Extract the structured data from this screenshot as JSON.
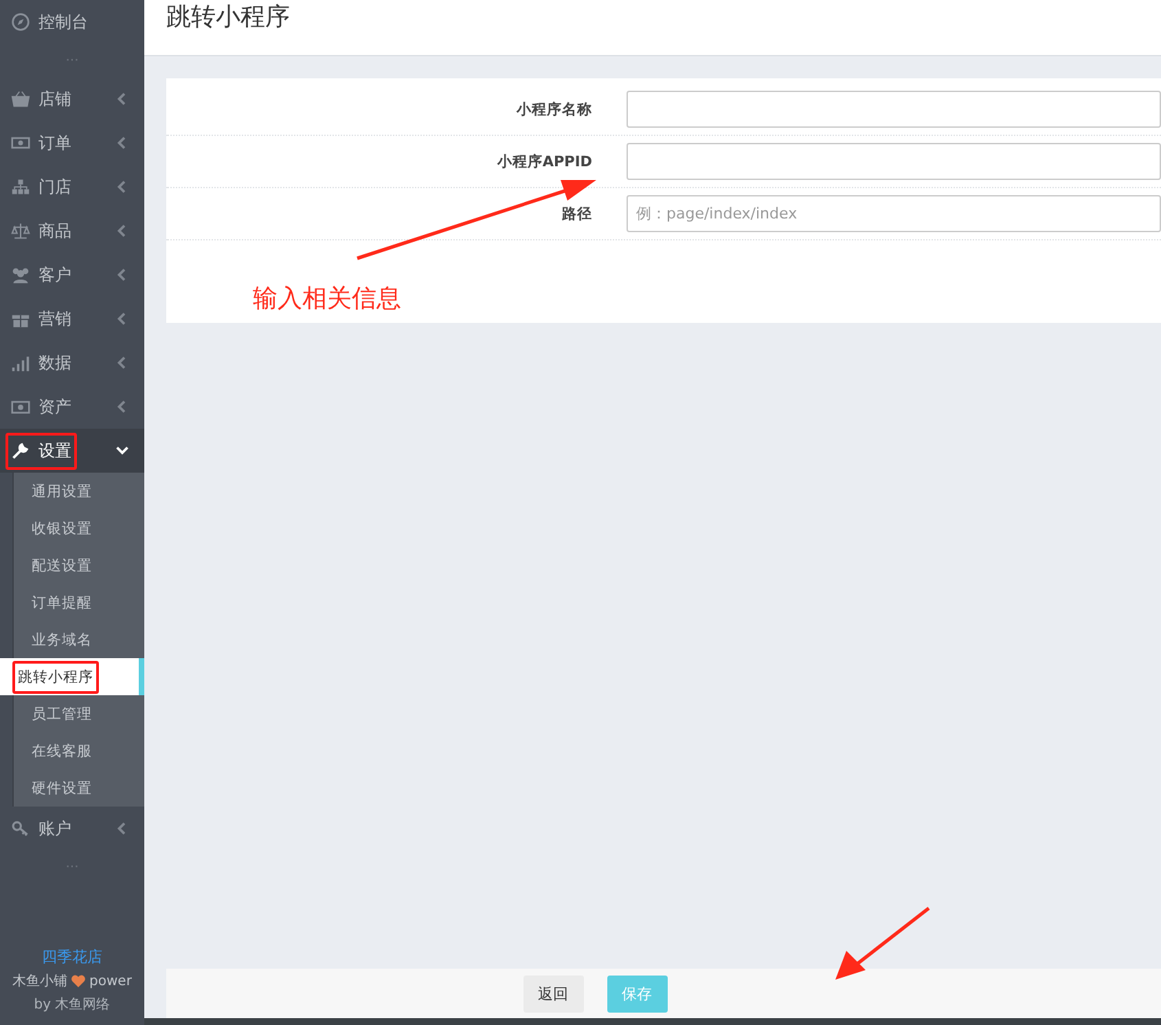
{
  "sidebar": {
    "items": [
      {
        "label": "控制台",
        "kind": "link"
      },
      {
        "kind": "more",
        "label": "···"
      },
      {
        "label": "店铺",
        "kind": "menu",
        "expanded": false,
        "highlighted": false
      },
      {
        "label": "订单",
        "kind": "menu",
        "expanded": false,
        "highlighted": false
      },
      {
        "label": "门店",
        "kind": "menu",
        "expanded": false,
        "highlighted": false
      },
      {
        "label": "商品",
        "kind": "menu",
        "expanded": false,
        "highlighted": false
      },
      {
        "label": "客户",
        "kind": "menu",
        "expanded": false,
        "highlighted": false
      },
      {
        "label": "营销",
        "kind": "menu",
        "expanded": false,
        "highlighted": false
      },
      {
        "label": "数据",
        "kind": "menu",
        "expanded": false,
        "highlighted": false
      },
      {
        "label": "资产",
        "kind": "menu",
        "expanded": false,
        "highlighted": false
      },
      {
        "label": "设置",
        "kind": "menu",
        "expanded": true,
        "highlighted": true,
        "children": [
          {
            "label": "通用设置",
            "selected": false,
            "highlighted": false
          },
          {
            "label": "收银设置",
            "selected": false,
            "highlighted": false
          },
          {
            "label": "配送设置",
            "selected": false,
            "highlighted": false
          },
          {
            "label": "订单提醒",
            "selected": false,
            "highlighted": false
          },
          {
            "label": "业务域名",
            "selected": false,
            "highlighted": false
          },
          {
            "label": "跳转小程序",
            "selected": true,
            "highlighted": true
          },
          {
            "label": "员工管理",
            "selected": false,
            "highlighted": false
          },
          {
            "label": "在线客服",
            "selected": false,
            "highlighted": false
          },
          {
            "label": "硬件设置",
            "selected": false,
            "highlighted": false
          }
        ]
      },
      {
        "label": "账户",
        "kind": "menu",
        "expanded": false,
        "highlighted": false
      },
      {
        "kind": "more",
        "label": "···"
      }
    ],
    "footer": {
      "shop": "四季花店",
      "brand": "木鱼小铺",
      "power": "power",
      "by": "by 木鱼网络"
    }
  },
  "page": {
    "title": "跳转小程序",
    "form": [
      {
        "label": "小程序名称"
      },
      {
        "label": "小程序APPID"
      },
      {
        "label": "路径",
        "placeholder": "例：page/index/index"
      }
    ],
    "annotation": "输入相关信息",
    "buttons": [
      {
        "label": "返回",
        "kind": "default"
      },
      {
        "label": "保存",
        "kind": "primary"
      }
    ]
  }
}
